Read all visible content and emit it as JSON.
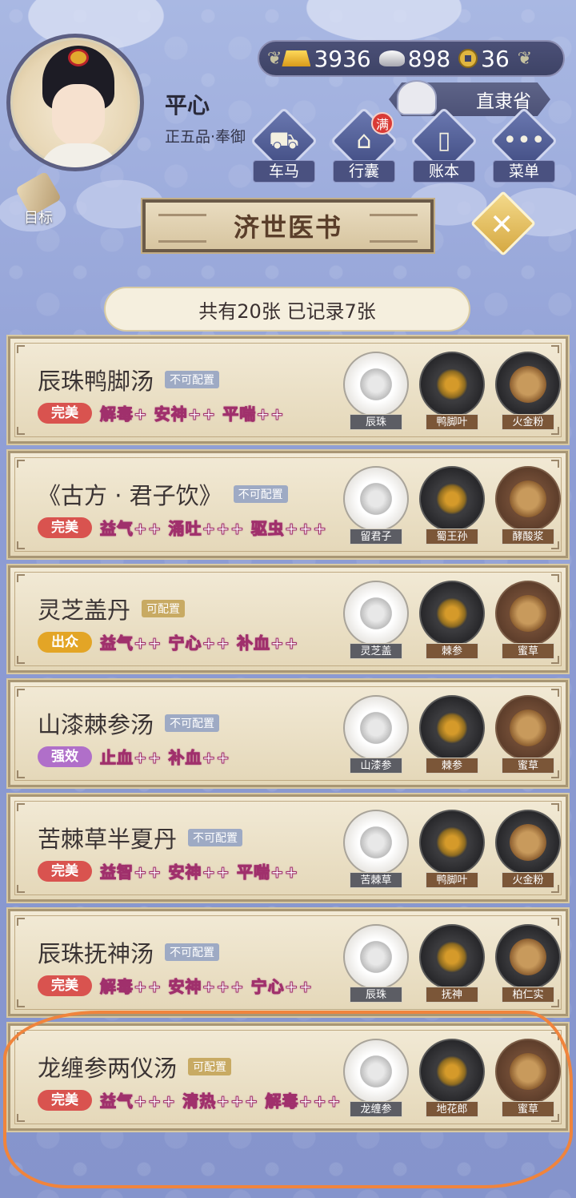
{
  "player": {
    "name": "平心",
    "rank": "正五品·奉御"
  },
  "currency": {
    "gold": "3936",
    "silver": "898",
    "coins": "36"
  },
  "province": "直隶省",
  "nav": [
    {
      "label": "车马",
      "icon": "carriage-icon"
    },
    {
      "label": "行囊",
      "icon": "bag-icon",
      "badge": "满"
    },
    {
      "label": "账本",
      "icon": "ledger-icon"
    },
    {
      "label": "菜单",
      "icon": "menu-icon"
    }
  ],
  "goal_label": "目标",
  "title": "济世医书",
  "close_label": "✕",
  "count_text": "共有20张 已记录7张",
  "colors": {
    "perfect": "#d9534f",
    "excellent": "#e3a526",
    "strong": "#b06fc9",
    "highlight": "#f0843c"
  },
  "recipes": [
    {
      "name": "辰珠鸭脚汤",
      "config": "不可配置",
      "quality": "完美",
      "effects": "解毒+ 安神++ 平喘++",
      "ingredients": [
        {
          "name": "辰珠",
          "plate": "white"
        },
        {
          "name": "鸭脚叶",
          "plate": "black"
        },
        {
          "name": "火金粉",
          "plate": "black"
        }
      ]
    },
    {
      "name": "《古方 · 君子饮》",
      "config": "不可配置",
      "quality": "完美",
      "effects": "益气++ 涌吐+++ 驱虫+++",
      "ingredients": [
        {
          "name": "留君子",
          "plate": "white"
        },
        {
          "name": "蜀王孙",
          "plate": "black"
        },
        {
          "name": "酵酸浆",
          "plate": "brown"
        }
      ]
    },
    {
      "name": "灵芝盖丹",
      "config": "可配置",
      "quality": "出众",
      "effects": "益气++ 宁心++ 补血++",
      "ingredients": [
        {
          "name": "灵芝盖",
          "plate": "white"
        },
        {
          "name": "棘参",
          "plate": "black"
        },
        {
          "name": "蜜草",
          "plate": "brown"
        }
      ]
    },
    {
      "name": "山漆棘参汤",
      "config": "不可配置",
      "quality": "强效",
      "effects": "止血++ 补血++",
      "ingredients": [
        {
          "name": "山漆参",
          "plate": "white"
        },
        {
          "name": "棘参",
          "plate": "black"
        },
        {
          "name": "蜜草",
          "plate": "brown"
        }
      ]
    },
    {
      "name": "苦棘草半夏丹",
      "config": "不可配置",
      "quality": "完美",
      "effects": "益智++ 安神++ 平喘++",
      "ingredients": [
        {
          "name": "苦棘草",
          "plate": "white"
        },
        {
          "name": "鸭脚叶",
          "plate": "black"
        },
        {
          "name": "火金粉",
          "plate": "black"
        }
      ]
    },
    {
      "name": "辰珠抚神汤",
      "config": "不可配置",
      "quality": "完美",
      "effects": "解毒++ 安神+++ 宁心++",
      "ingredients": [
        {
          "name": "辰珠",
          "plate": "white"
        },
        {
          "name": "抚神",
          "plate": "black"
        },
        {
          "name": "柏仁实",
          "plate": "black"
        }
      ]
    },
    {
      "name": "龙缠参两仪汤",
      "config": "可配置",
      "quality": "完美",
      "effects": "益气+++ 清热+++ 解毒+++",
      "ingredients": [
        {
          "name": "龙缠参",
          "plate": "white"
        },
        {
          "name": "地花郎",
          "plate": "black"
        },
        {
          "name": "蜜草",
          "plate": "brown"
        }
      ]
    }
  ]
}
